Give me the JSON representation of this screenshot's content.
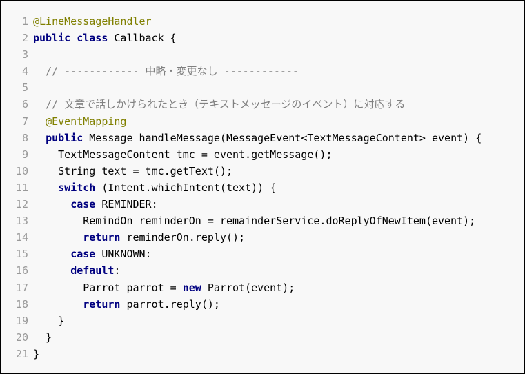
{
  "colors": {
    "annotation": "#808000",
    "keyword": "#000080",
    "comment": "#808080",
    "text": "#000000",
    "line_number": "#999999",
    "background": "#f8f8f8"
  },
  "lines": [
    {
      "num": "1",
      "tokens": [
        {
          "t": "ann",
          "v": "@LineMessageHandler"
        }
      ]
    },
    {
      "num": "2",
      "tokens": [
        {
          "t": "kw",
          "v": "public"
        },
        {
          "t": "txt",
          "v": " "
        },
        {
          "t": "kw",
          "v": "class"
        },
        {
          "t": "txt",
          "v": " Callback {"
        }
      ]
    },
    {
      "num": "3",
      "tokens": []
    },
    {
      "num": "4",
      "tokens": [
        {
          "t": "txt",
          "v": "  "
        },
        {
          "t": "cm",
          "v": "// ------------ 中略・変更なし ------------"
        }
      ]
    },
    {
      "num": "5",
      "tokens": []
    },
    {
      "num": "6",
      "tokens": [
        {
          "t": "txt",
          "v": "  "
        },
        {
          "t": "cm",
          "v": "// 文章で話しかけられたとき（テキストメッセージのイベント）に対応する"
        }
      ]
    },
    {
      "num": "7",
      "tokens": [
        {
          "t": "txt",
          "v": "  "
        },
        {
          "t": "ann",
          "v": "@EventMapping"
        }
      ]
    },
    {
      "num": "8",
      "tokens": [
        {
          "t": "txt",
          "v": "  "
        },
        {
          "t": "kw",
          "v": "public"
        },
        {
          "t": "txt",
          "v": " Message handleMessage(MessageEvent<TextMessageContent> event) {"
        }
      ]
    },
    {
      "num": "9",
      "tokens": [
        {
          "t": "txt",
          "v": "    TextMessageContent tmc = event.getMessage();"
        }
      ]
    },
    {
      "num": "10",
      "tokens": [
        {
          "t": "txt",
          "v": "    String text = tmc.getText();"
        }
      ]
    },
    {
      "num": "11",
      "tokens": [
        {
          "t": "txt",
          "v": "    "
        },
        {
          "t": "kw",
          "v": "switch"
        },
        {
          "t": "txt",
          "v": " (Intent.whichIntent(text)) {"
        }
      ]
    },
    {
      "num": "12",
      "tokens": [
        {
          "t": "txt",
          "v": "      "
        },
        {
          "t": "kw",
          "v": "case"
        },
        {
          "t": "txt",
          "v": " REMINDER:"
        }
      ]
    },
    {
      "num": "13",
      "tokens": [
        {
          "t": "txt",
          "v": "        RemindOn reminderOn = remainderService.doReplyOfNewItem(event);"
        }
      ]
    },
    {
      "num": "14",
      "tokens": [
        {
          "t": "txt",
          "v": "        "
        },
        {
          "t": "kw",
          "v": "return"
        },
        {
          "t": "txt",
          "v": " reminderOn.reply();"
        }
      ]
    },
    {
      "num": "15",
      "tokens": [
        {
          "t": "txt",
          "v": "      "
        },
        {
          "t": "kw",
          "v": "case"
        },
        {
          "t": "txt",
          "v": " UNKNOWN:"
        }
      ]
    },
    {
      "num": "16",
      "tokens": [
        {
          "t": "txt",
          "v": "      "
        },
        {
          "t": "kw",
          "v": "default"
        },
        {
          "t": "txt",
          "v": ":"
        }
      ]
    },
    {
      "num": "17",
      "tokens": [
        {
          "t": "txt",
          "v": "        Parrot parrot = "
        },
        {
          "t": "kw",
          "v": "new"
        },
        {
          "t": "txt",
          "v": " Parrot(event);"
        }
      ]
    },
    {
      "num": "18",
      "tokens": [
        {
          "t": "txt",
          "v": "        "
        },
        {
          "t": "kw",
          "v": "return"
        },
        {
          "t": "txt",
          "v": " parrot.reply();"
        }
      ]
    },
    {
      "num": "19",
      "tokens": [
        {
          "t": "txt",
          "v": "    }"
        }
      ]
    },
    {
      "num": "20",
      "tokens": [
        {
          "t": "txt",
          "v": "  }"
        }
      ]
    },
    {
      "num": "21",
      "tokens": [
        {
          "t": "txt",
          "v": "}"
        }
      ]
    }
  ]
}
